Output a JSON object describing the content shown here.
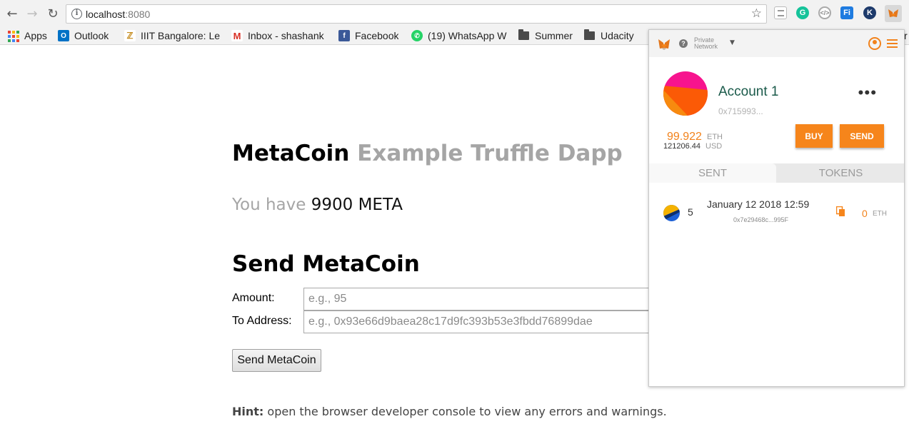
{
  "browser": {
    "url_host": "localhost",
    "url_port": ":8080",
    "bookmarks": [
      {
        "label": "Apps",
        "icon": "apps-grid-icon"
      },
      {
        "label": "Outlook",
        "icon": "outlook-icon"
      },
      {
        "label": "IIIT Bangalore: Le",
        "icon": "iiitb-icon"
      },
      {
        "label": "Inbox - shashank",
        "icon": "gmail-icon"
      },
      {
        "label": "Facebook",
        "icon": "facebook-icon"
      },
      {
        "label": "(19) WhatsApp W",
        "icon": "whatsapp-icon"
      },
      {
        "label": "Summer",
        "icon": "folder-icon"
      },
      {
        "label": "Udacity",
        "icon": "folder-icon"
      }
    ],
    "bookmark_overflow": "r",
    "extensions": [
      "reader-icon",
      "grammarly-icon",
      "code-icon",
      "fi-icon",
      "k-icon",
      "metamask-fox-icon"
    ]
  },
  "page": {
    "title_main": "MetaCoin",
    "title_sub": "Example Truffle Dapp",
    "balance_prefix": "You have",
    "balance_amount": "9900",
    "balance_unit": "META",
    "send_heading": "Send MetaCoin",
    "amount_label": "Amount:",
    "amount_placeholder": "e.g., 95",
    "address_label": "To Address:",
    "address_placeholder": "e.g., 0x93e66d9baea28c17d9fc393b53e3fbdd76899dae",
    "send_button": "Send MetaCoin",
    "hint_label": "Hint:",
    "hint_text": "open the browser developer console to view any errors and warnings."
  },
  "metamask": {
    "network_line1": "Private",
    "network_line2": "Network",
    "account_name": "Account 1",
    "account_address": "0x715993...",
    "more_label": "•••",
    "eth_balance": "99.922",
    "eth_unit": "ETH",
    "usd_balance": "121206.44",
    "usd_unit": "USD",
    "buy_label": "BUY",
    "send_label": "SEND",
    "tabs": [
      {
        "label": "SENT",
        "active": true
      },
      {
        "label": "TOKENS",
        "active": false
      }
    ],
    "transactions": [
      {
        "nonce": "5",
        "date": "January 12 2018 12:59",
        "hash": "0x7e29468c...995F",
        "value": "0",
        "unit": "ETH"
      }
    ],
    "colors": {
      "accent": "#f6851b",
      "account_name": "#1a5a4a"
    }
  }
}
